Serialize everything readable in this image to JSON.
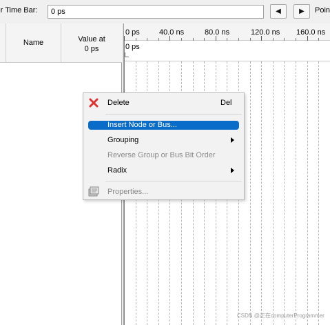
{
  "toolbar": {
    "master_time_bar_label": "ster Time Bar:",
    "master_time_bar_value": "0 ps",
    "prev_button": "◀",
    "next_button": "▶",
    "pointer_label": "Point"
  },
  "node_table": {
    "name_header": "Name",
    "value_header_line1": "Value at",
    "value_header_line2": "0 ps"
  },
  "waveform": {
    "ruler_ticks": [
      "0 ps",
      "40.0 ns",
      "80.0 ns",
      "120.0 ns",
      "160.0 ns"
    ],
    "cursor_label": "0 ps"
  },
  "context_menu": {
    "items": [
      {
        "label": "Delete",
        "shortcut": "Del",
        "enabled": true,
        "icon": "delete-x-icon"
      },
      {
        "label": "Insert Node or Bus...",
        "enabled": true,
        "highlighted": true
      },
      {
        "label": "Grouping",
        "enabled": true,
        "submenu": true
      },
      {
        "label": "Reverse Group or Bus Bit Order",
        "enabled": false
      },
      {
        "label": "Radix",
        "enabled": true,
        "submenu": true
      },
      {
        "label": "Properties...",
        "enabled": false,
        "icon": "properties-icon"
      }
    ]
  },
  "watermark": "CSDN @正在computerProgrammer",
  "colors": {
    "highlight": "#0a6cc9",
    "delete_icon": "#e03030",
    "disabled_text": "#8a8a8a"
  }
}
